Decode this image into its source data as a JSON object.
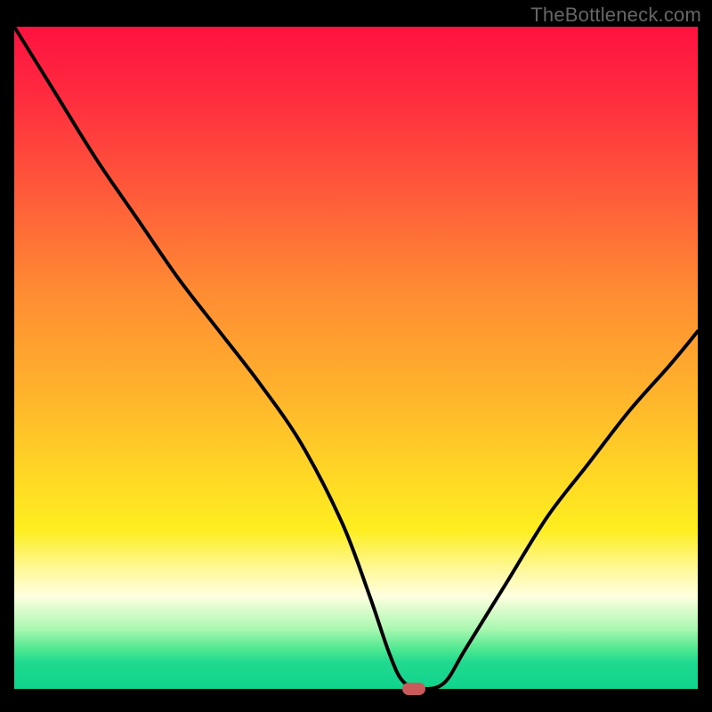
{
  "watermark": "TheBottleneck.com",
  "chart_data": {
    "type": "line",
    "title": "",
    "xlabel": "",
    "ylabel": "",
    "xlim": [
      0,
      100
    ],
    "ylim": [
      0,
      100
    ],
    "grid": false,
    "series": [
      {
        "name": "curve",
        "x": [
          0,
          6,
          12,
          18,
          24,
          30,
          36,
          42,
          48,
          52,
          55,
          57,
          60,
          63,
          66,
          72,
          78,
          84,
          90,
          96,
          100
        ],
        "values": [
          100,
          90,
          80,
          71,
          62,
          54,
          46,
          37,
          25,
          14,
          5,
          1,
          0,
          1,
          6,
          16,
          26,
          34,
          42,
          49,
          54
        ]
      }
    ],
    "marker": {
      "x": 58.5,
      "y": 0
    },
    "background_gradient": {
      "top": "#ff1240",
      "mid": "#ffd825",
      "bottom": "#10d48c"
    }
  },
  "colors": {
    "curve": "#000000",
    "marker": "#c85a5a",
    "frame": "#000000"
  }
}
